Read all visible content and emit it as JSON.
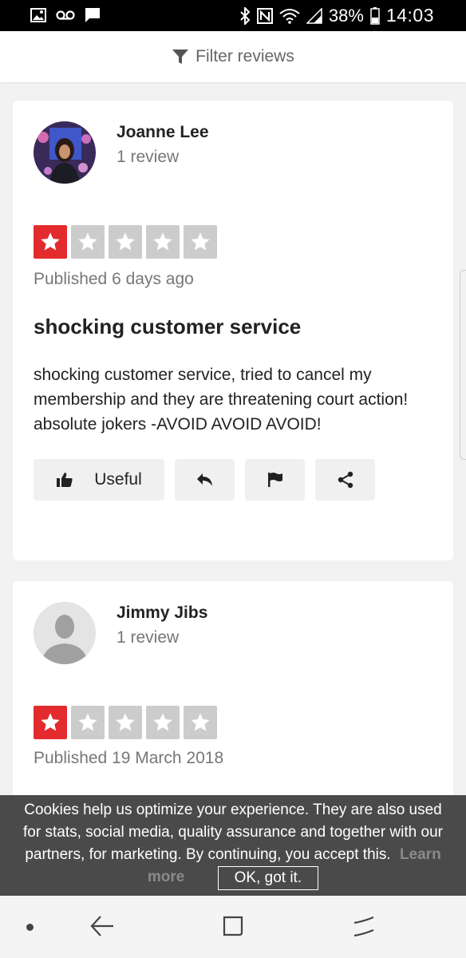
{
  "status_bar": {
    "battery": "38%",
    "time": "14:03",
    "icons": [
      "image-icon",
      "voicemail-icon",
      "message-icon",
      "bluetooth-icon",
      "nfc-icon",
      "wifi-icon",
      "signal-icon",
      "battery-icon"
    ]
  },
  "filter": {
    "label": "Filter reviews",
    "icon": "filter-icon"
  },
  "reviews": [
    {
      "name": "Joanne Lee",
      "count": "1 review",
      "rating": 1,
      "max_rating": 5,
      "published": "Published 6 days ago",
      "title": "shocking customer service",
      "body": "shocking customer service, tried to cancel my membership and they are threatening court action! absolute jokers -AVOID AVOID AVOID!",
      "actions": {
        "useful_label": "Useful"
      }
    },
    {
      "name": "Jimmy Jibs",
      "count": "1 review",
      "rating": 1,
      "max_rating": 5,
      "published": "Published 19 March 2018"
    }
  ],
  "cookie": {
    "text": "Cookies help us optimize your experience. They are also used for stats, social media, quality assurance and together with our partners, for marketing. By continuing, you accept this.",
    "learn_more": "Learn more",
    "ok": "OK, got it."
  },
  "colors": {
    "star_on": "#e32b2e",
    "star_off": "#cccccc",
    "cookie_bg": "#4a4a4a"
  }
}
